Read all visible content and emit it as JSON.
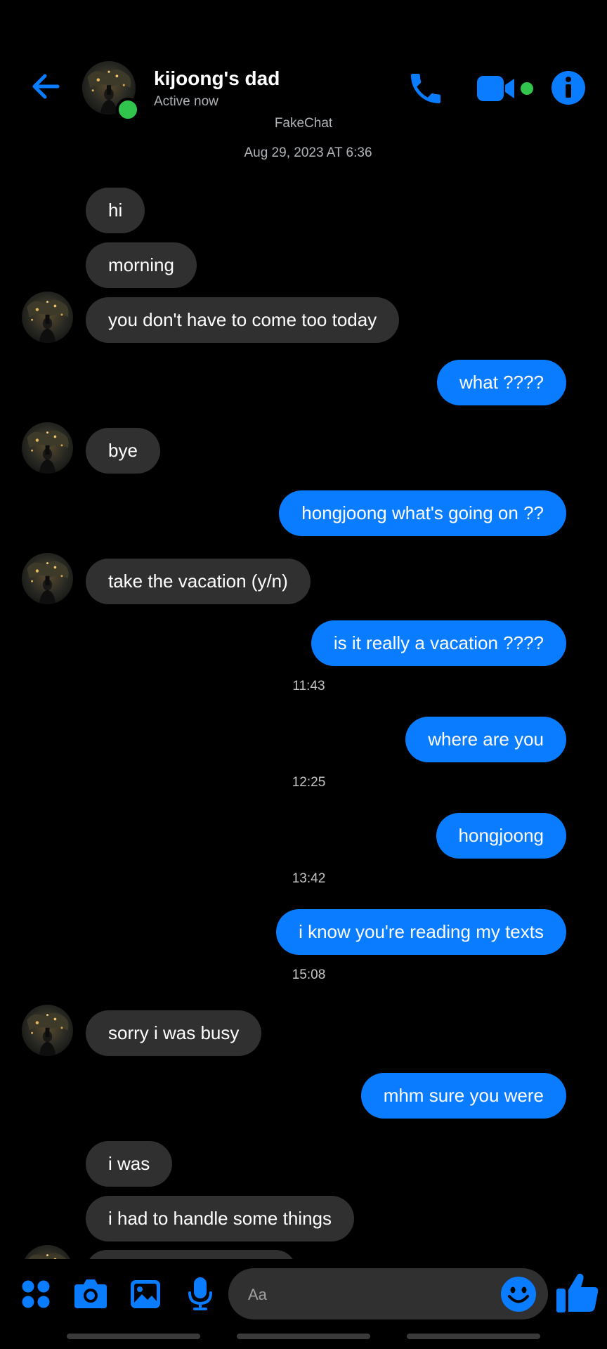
{
  "header": {
    "contact_name": "kijoong's dad",
    "status": "Active now",
    "app_label": "FakeChat",
    "date": "Aug 29, 2023 AT 6:36"
  },
  "messages": [
    {
      "from": "them",
      "text": "hi"
    },
    {
      "from": "them",
      "text": "morning"
    },
    {
      "from": "them",
      "text": "you don't have to come too today"
    },
    {
      "from": "me",
      "text": "what ????"
    },
    {
      "from": "them",
      "text": "bye"
    },
    {
      "from": "me",
      "text": "hongjoong what's going on ??"
    },
    {
      "from": "them",
      "text": "take the vacation (y/n)"
    },
    {
      "from": "me",
      "text": "is it really a vacation ????"
    },
    {
      "from": "me",
      "text": "where are you"
    },
    {
      "from": "me",
      "text": "hongjoong"
    },
    {
      "from": "me",
      "text": "i know you're reading my texts"
    },
    {
      "from": "them",
      "text": "sorry i was busy"
    },
    {
      "from": "me",
      "text": "mhm sure you were"
    },
    {
      "from": "them",
      "text": "i was"
    },
    {
      "from": "them",
      "text": "i had to handle some things"
    }
  ],
  "timestamps": [
    "11:43",
    "12:25",
    "13:42",
    "15:08"
  ],
  "composer": {
    "placeholder": "Aa"
  },
  "icons": {
    "back": "back-arrow-icon",
    "call": "phone-icon",
    "video": "video-camera-icon",
    "info": "info-icon",
    "apps": "apps-grid-icon",
    "camera": "camera-icon",
    "gallery": "gallery-icon",
    "mic": "microphone-icon",
    "emoji": "emoji-icon",
    "like": "thumbs-up-icon"
  },
  "colors": {
    "accent": "#0a7cff",
    "incoming_bubble": "#303030",
    "online": "#31c54d",
    "background": "#000000"
  }
}
